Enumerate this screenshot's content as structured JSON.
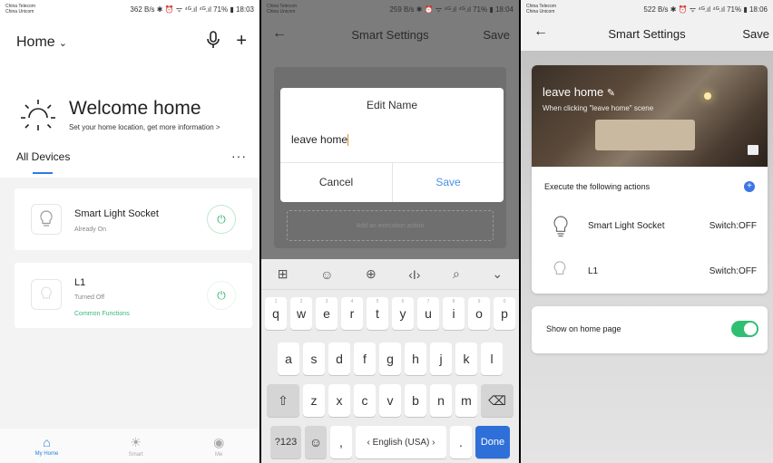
{
  "status_bar": {
    "carrier": "China Telecom\nChina Unicom",
    "p1": "362 B/s ✱ ⏰ ᯤ ⁴ᴳ.ıl ⁴ᴳ.ıl 71% ▮ 18:03",
    "p2": "259 B/s ✱ ⏰ ᯤ ⁴ᴳ.ıl ⁴ᴳ.ıl 71% ▮ 18:04",
    "p3": "522 B/s ✱ ⏰ ᯤ ⁴ᴳ.ıl ⁴ᴳ.ıl 71% ▮ 18:06"
  },
  "home": {
    "title": "Home",
    "welcome_title": "Welcome home",
    "welcome_sub": "Set your home location, get more information >",
    "all_devices": "All Devices",
    "more": "···",
    "devices": [
      {
        "name": "Smart Light Socket",
        "state": "Already On"
      },
      {
        "name": "L1",
        "state": "Turned Off",
        "common": "Common Functions"
      }
    ],
    "tabs": [
      "My Home",
      "Smart",
      "Me"
    ]
  },
  "edit": {
    "nav_title": "Smart Settings",
    "save": "Save",
    "dialog_title": "Edit Name",
    "input_value": "leave home",
    "cancel": "Cancel",
    "dialog_save": "Save",
    "add_action": "Add an execution action"
  },
  "keyboard": {
    "row1": [
      [
        "1",
        "q"
      ],
      [
        "2",
        "w"
      ],
      [
        "3",
        "e"
      ],
      [
        "4",
        "r"
      ],
      [
        "5",
        "t"
      ],
      [
        "6",
        "y"
      ],
      [
        "7",
        "u"
      ],
      [
        "8",
        "i"
      ],
      [
        "9",
        "o"
      ],
      [
        "0",
        "p"
      ]
    ],
    "row2": [
      "a",
      "s",
      "d",
      "f",
      "g",
      "h",
      "j",
      "k",
      "l"
    ],
    "row3": [
      "z",
      "x",
      "c",
      "v",
      "b",
      "n",
      "m"
    ],
    "symbols": "?123",
    "comma": ",",
    "space": "‹ English (USA) ›",
    "period": ".",
    "done": "Done"
  },
  "scene": {
    "nav_title": "Smart Settings",
    "save": "Save",
    "name": "leave home",
    "desc": "When clicking \"leave home\" scene",
    "exec_label": "Execute the following actions",
    "actions": [
      {
        "name": "Smart Light Socket",
        "value": "Switch:OFF"
      },
      {
        "name": "L1",
        "value": "Switch:OFF"
      }
    ],
    "show_home": "Show on home page",
    "show_home_on": true
  }
}
